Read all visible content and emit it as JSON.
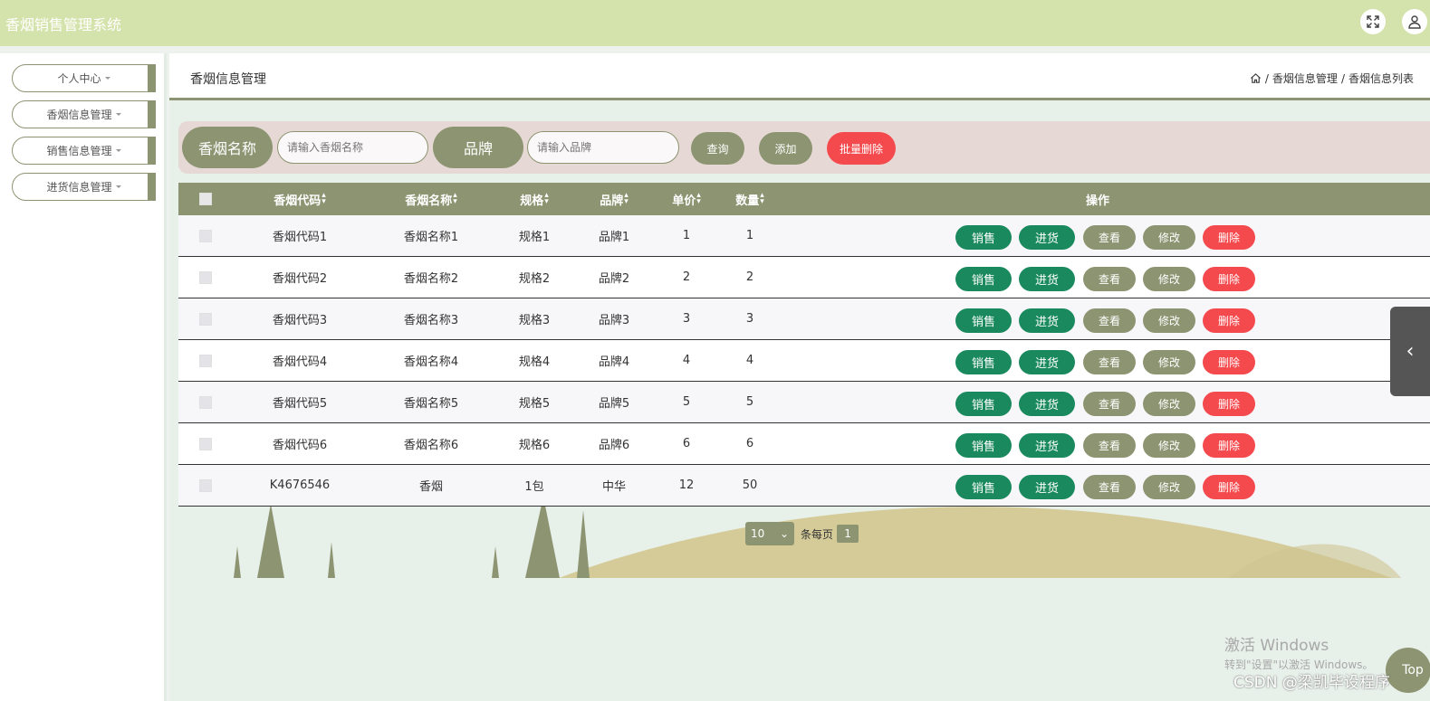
{
  "app": {
    "title": "香烟销售管理系统"
  },
  "topbar": {
    "fullscreen_icon": "fullscreen-icon",
    "user_icon": "user-icon"
  },
  "sidebar": {
    "items": [
      {
        "label": "个人中心"
      },
      {
        "label": "香烟信息管理"
      },
      {
        "label": "销售信息管理"
      },
      {
        "label": "进货信息管理"
      }
    ]
  },
  "header": {
    "title": "香烟信息管理",
    "breadcrumb": [
      "香烟信息管理",
      "香烟信息列表"
    ],
    "separator": "/"
  },
  "search": {
    "name_label": "香烟名称",
    "name_placeholder": "请输入香烟名称",
    "brand_label": "品牌",
    "brand_placeholder": "请输入品牌",
    "query_label": "查询",
    "add_label": "添加",
    "batch_delete_label": "批量删除"
  },
  "table": {
    "columns": [
      "香烟代码",
      "香烟名称",
      "规格",
      "品牌",
      "单价",
      "数量",
      "操作"
    ],
    "rows": [
      {
        "code": "香烟代码1",
        "name": "香烟名称1",
        "spec": "规格1",
        "brand": "品牌1",
        "price": "1",
        "qty": "1"
      },
      {
        "code": "香烟代码2",
        "name": "香烟名称2",
        "spec": "规格2",
        "brand": "品牌2",
        "price": "2",
        "qty": "2"
      },
      {
        "code": "香烟代码3",
        "name": "香烟名称3",
        "spec": "规格3",
        "brand": "品牌3",
        "price": "3",
        "qty": "3"
      },
      {
        "code": "香烟代码4",
        "name": "香烟名称4",
        "spec": "规格4",
        "brand": "品牌4",
        "price": "4",
        "qty": "4"
      },
      {
        "code": "香烟代码5",
        "name": "香烟名称5",
        "spec": "规格5",
        "brand": "品牌5",
        "price": "5",
        "qty": "5"
      },
      {
        "code": "香烟代码6",
        "name": "香烟名称6",
        "spec": "规格6",
        "brand": "品牌6",
        "price": "6",
        "qty": "6"
      },
      {
        "code": "K4676546",
        "name": "香烟",
        "spec": "1包",
        "brand": "中华",
        "price": "12",
        "qty": "50"
      }
    ],
    "actions": {
      "sale": "销售",
      "stock": "进货",
      "view": "查看",
      "edit": "修改",
      "delete": "删除"
    }
  },
  "pagination": {
    "page_size": "10",
    "per_page_label": "条每页",
    "current_page": "1"
  },
  "overlay": {
    "windows_line1": "激活 Windows",
    "windows_line2": "转到\"设置\"以激活 Windows。",
    "csdn": "CSDN @梁凯毕设程序",
    "top_button": "Top"
  },
  "colors": {
    "topbar": "#d4e3ac",
    "accent": "#8d9472",
    "green_button": "#1a8a5e",
    "danger": "#f44a4e",
    "search_bg": "#e6d9d5"
  }
}
